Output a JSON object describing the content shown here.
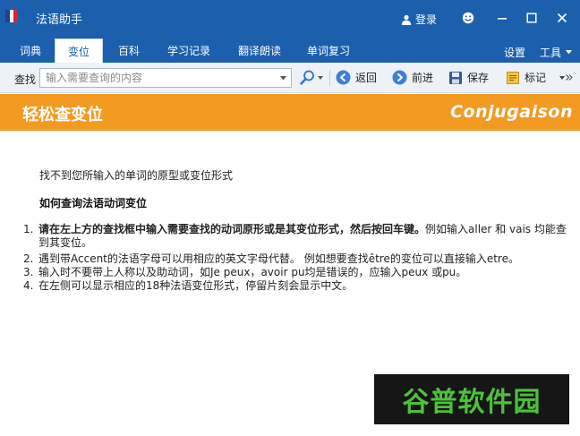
{
  "window": {
    "title": "法语助手",
    "login_label": "登录",
    "flag_colors": [
      "#1f3f9e",
      "#ffffff",
      "#d9232e"
    ]
  },
  "menu": {
    "tabs": [
      {
        "label": "词典"
      },
      {
        "label": "变位",
        "active": true
      },
      {
        "label": "百科"
      },
      {
        "label": "学习记录"
      },
      {
        "label": "翻译朗读"
      },
      {
        "label": "单词复习"
      }
    ],
    "settings_label": "设置",
    "tools_label": "工具"
  },
  "toolbar": {
    "search_label": "查找",
    "search_placeholder": "输入需要查询的内容",
    "back_label": "返回",
    "forward_label": "前进",
    "save_label": "保存",
    "mark_label": "标记"
  },
  "banner": {
    "title": "轻松查变位",
    "subtitle": "Conjugaison"
  },
  "content": {
    "not_found": "找不到您所输入的单词的原型或变位形式",
    "howto_title": "如何查询法语动词变位",
    "steps": [
      {
        "num": "1.",
        "bold": "请在左上方的查找框中输入需要查找的动词原形或是其变位形式，然后按回车键。",
        "text": "例如输入aller 和 vais 均能查到其变位。"
      },
      {
        "num": "2.",
        "bold": "",
        "text": "遇到带Accent的法语字母可以用相应的英文字母代替。 例如想要查找être的变位可以直接输入etre。"
      },
      {
        "num": "3.",
        "bold": "",
        "text": "输入时不要带上人称以及助动词，如Je peux，avoir pu均是错误的，应输入peux 或pu。"
      },
      {
        "num": "4.",
        "bold": "",
        "text": "在左侧可以显示相应的18种法语变位形式，停留片刻会显示中文。"
      }
    ]
  },
  "watermark": {
    "text": "谷普软件园"
  },
  "colors": {
    "titlebar": "#1b5fad",
    "banner": "#f39a23",
    "watermark_text": "#4cc23a"
  }
}
